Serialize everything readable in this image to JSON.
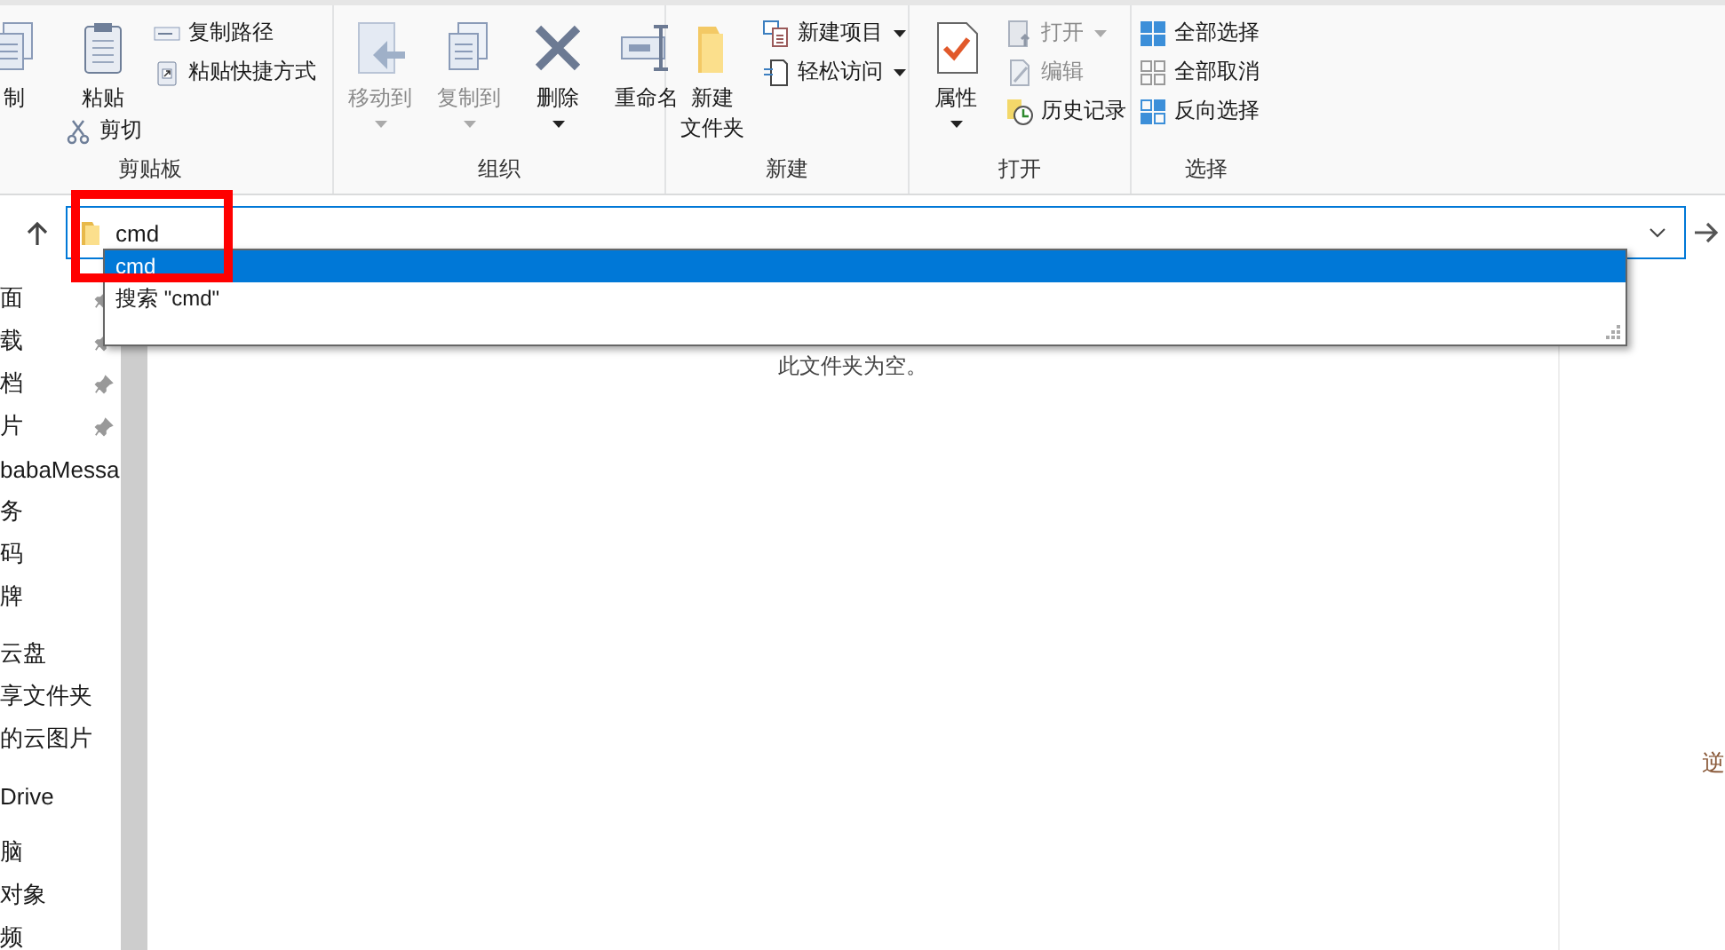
{
  "ribbon": {
    "groups": [
      {
        "label": "剪贴板",
        "columns": [
          [
            {
              "kind": "large",
              "label": "制",
              "disabled": false,
              "dropdown": false
            }
          ],
          [
            {
              "kind": "large",
              "label": "粘贴",
              "disabled": false,
              "dropdown": false
            },
            {
              "kind": "small",
              "label": "剪切",
              "disabled": false,
              "dropdown": false
            }
          ],
          [
            {
              "kind": "small",
              "label": "复制路径",
              "disabled": false,
              "dropdown": false
            },
            {
              "kind": "small",
              "label": "粘贴快捷方式",
              "disabled": false,
              "dropdown": false
            }
          ]
        ]
      },
      {
        "label": "组织",
        "columns": [
          [
            {
              "kind": "large",
              "label": "移动到",
              "disabled": true,
              "dropdown": true
            }
          ],
          [
            {
              "kind": "large",
              "label": "复制到",
              "disabled": true,
              "dropdown": true
            }
          ],
          [
            {
              "kind": "large",
              "label": "删除",
              "disabled": false,
              "dropdown": true
            }
          ],
          [
            {
              "kind": "large",
              "label": "重命名",
              "disabled": false,
              "dropdown": false
            }
          ]
        ]
      },
      {
        "label": "新建",
        "columns": [
          [
            {
              "kind": "large",
              "lines": [
                "新建",
                "文件夹"
              ],
              "disabled": false,
              "dropdown": false
            }
          ],
          [
            {
              "kind": "small",
              "label": "新建项目",
              "disabled": false,
              "dropdown": true
            },
            {
              "kind": "small",
              "label": "轻松访问",
              "disabled": false,
              "dropdown": true
            }
          ]
        ]
      },
      {
        "label": "打开",
        "columns": [
          [
            {
              "kind": "large",
              "label": "属性",
              "disabled": false,
              "dropdown": true
            }
          ],
          [
            {
              "kind": "small",
              "label": "打开",
              "disabled": true,
              "dropdown": true
            },
            {
              "kind": "small",
              "label": "编辑",
              "disabled": true,
              "dropdown": false
            },
            {
              "kind": "small",
              "label": "历史记录",
              "disabled": false,
              "dropdown": false
            }
          ]
        ]
      },
      {
        "label": "选择",
        "columns": [
          [
            {
              "kind": "small",
              "label": "全部选择",
              "disabled": false,
              "dropdown": false
            },
            {
              "kind": "small",
              "label": "全部取消",
              "disabled": false,
              "dropdown": false
            },
            {
              "kind": "small",
              "label": "反向选择",
              "disabled": false,
              "dropdown": false
            }
          ]
        ]
      }
    ]
  },
  "address": {
    "value": "cmd",
    "suggestions": [
      {
        "label": "cmd",
        "selected": true
      },
      {
        "label": "搜索 \"cmd\"",
        "selected": false
      }
    ]
  },
  "sidebar": {
    "sections": [
      [
        {
          "label": "面",
          "pinned": true
        },
        {
          "label": "载",
          "pinned": true
        },
        {
          "label": "档",
          "pinned": true
        },
        {
          "label": "片",
          "pinned": true
        },
        {
          "label": "babaMessa",
          "pinned": false
        },
        {
          "label": "务",
          "pinned": false
        },
        {
          "label": "码",
          "pinned": false
        },
        {
          "label": "牌",
          "pinned": false
        }
      ],
      [
        {
          "label": "云盘",
          "pinned": false
        },
        {
          "label": "享文件夹",
          "pinned": false
        },
        {
          "label": "的云图片",
          "pinned": false
        }
      ],
      [
        {
          "label": "Drive",
          "pinned": false
        }
      ],
      [
        {
          "label": "脑",
          "pinned": false
        },
        {
          "label": "对象",
          "pinned": false
        },
        {
          "label": "频",
          "pinned": false
        }
      ]
    ]
  },
  "content": {
    "empty_message": "此文件夹为空。"
  },
  "details_pane": {
    "text": "逆"
  }
}
